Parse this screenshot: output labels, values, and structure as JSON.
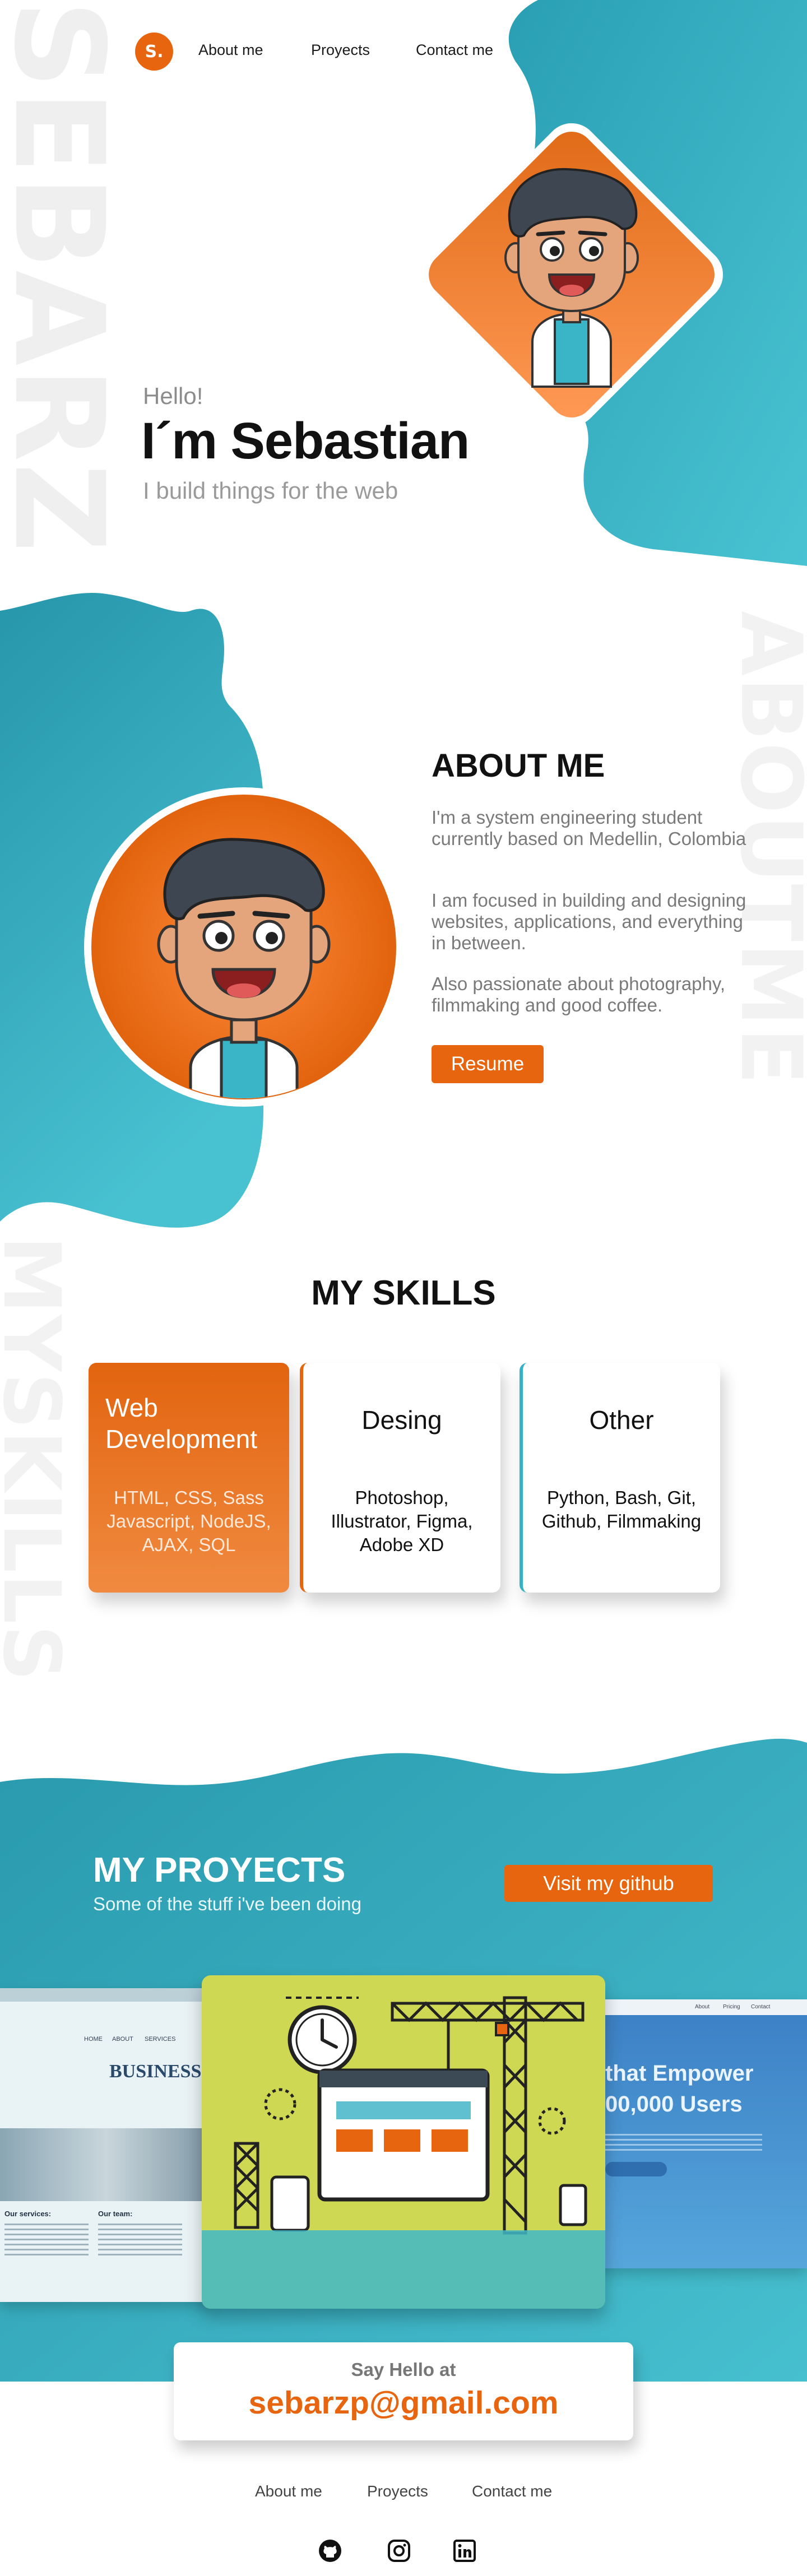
{
  "brand": {
    "logo_text": "S.",
    "accent": "#e8650f",
    "teal": "#35b3c6"
  },
  "nav": {
    "about": "About me",
    "projects": "Proyects",
    "contact": "Contact me"
  },
  "watermarks": {
    "hero": "SEBARZ",
    "about": "ABOUTME",
    "skills": "MYSKILLS"
  },
  "hero": {
    "greeting": "Hello!",
    "name": "I´m Sebastian",
    "tagline": "I build things for the web"
  },
  "about": {
    "title": "ABOUT ME",
    "p1": "I'm a system engineering student currently based on Medellin, Colombia",
    "p2": "I am focused in building and designing websites, applications, and everything in between.",
    "p3": "Also passionate about photography, filmmaking and good coffee.",
    "resume_label": "Resume"
  },
  "skills": {
    "title": "MY SKILLS",
    "cards": [
      {
        "title": "Web Development",
        "body": "HTML, CSS, Sass Javascript, NodeJS, AJAX, SQL"
      },
      {
        "title": "Desing",
        "body": "Photoshop, Illustrator, Figma, Adobe XD"
      },
      {
        "title": "Other",
        "body": "Python, Bash, Git, Github, Filmmaking"
      }
    ]
  },
  "projects": {
    "title": "MY PROYECTS",
    "subtitle": "Some of the stuff i've been doing",
    "github_label": "Visit my github",
    "left_shot": {
      "headline": "BUSINESS W",
      "nav_items": [
        "HOME",
        "ABOUT",
        "SERVICES"
      ],
      "col1_title": "Our services:",
      "col2_title": "Our team:"
    },
    "right_shot": {
      "line1": "that Empower",
      "line2": "00,000 Users",
      "nav_items": [
        "About",
        "Pricing",
        "Contact"
      ]
    }
  },
  "contact": {
    "label": "Say Hello at",
    "email": "sebarzp@gmail.com"
  },
  "footer": {
    "about": "About me",
    "projects": "Proyects",
    "contact": "Contact me"
  },
  "social": {
    "icons": [
      "github-icon",
      "instagram-icon",
      "linkedin-icon"
    ]
  }
}
